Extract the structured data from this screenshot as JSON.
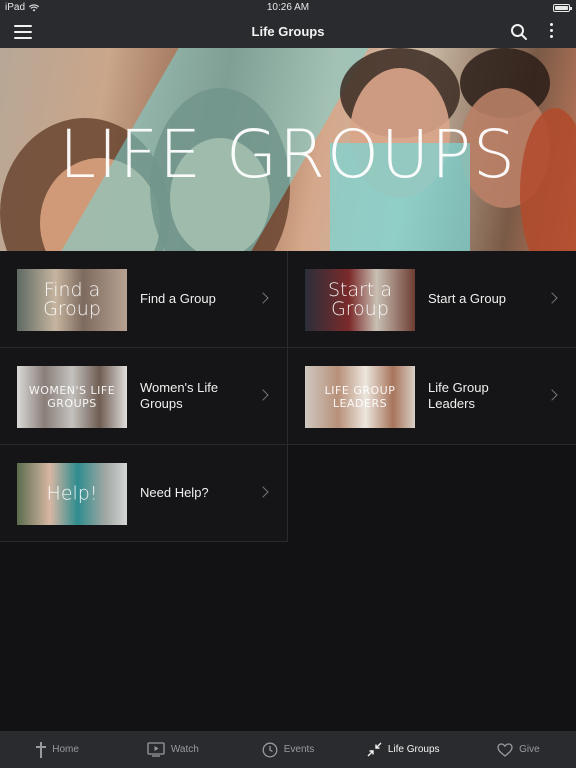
{
  "status_bar": {
    "device": "iPad",
    "time": "10:26 AM"
  },
  "nav": {
    "title": "Life Groups"
  },
  "hero": {
    "title": "LIFE GROUPS"
  },
  "items": [
    {
      "thumb_text": "Find a Group",
      "label": "Find a Group"
    },
    {
      "thumb_text": "Start a Group",
      "label": "Start a Group"
    },
    {
      "thumb_text": "WOMEN'S LIFE GROUPS",
      "label": "Women's Life Groups"
    },
    {
      "thumb_text": "LIFE GROUP LEADERS",
      "label": "Life Group Leaders"
    },
    {
      "thumb_text": "Help!",
      "label": "Need Help?"
    }
  ],
  "tabs": [
    {
      "label": "Home",
      "icon": "cross-icon",
      "active": false
    },
    {
      "label": "Watch",
      "icon": "tv-play-icon",
      "active": false
    },
    {
      "label": "Events",
      "icon": "clock-icon",
      "active": false
    },
    {
      "label": "Life Groups",
      "icon": "arrows-in-icon",
      "active": true
    },
    {
      "label": "Give",
      "icon": "heart-icon",
      "active": false
    }
  ],
  "colors": {
    "background": "#121214",
    "bar": "#2a2b2e",
    "accent_teal": "#78d7d7"
  }
}
